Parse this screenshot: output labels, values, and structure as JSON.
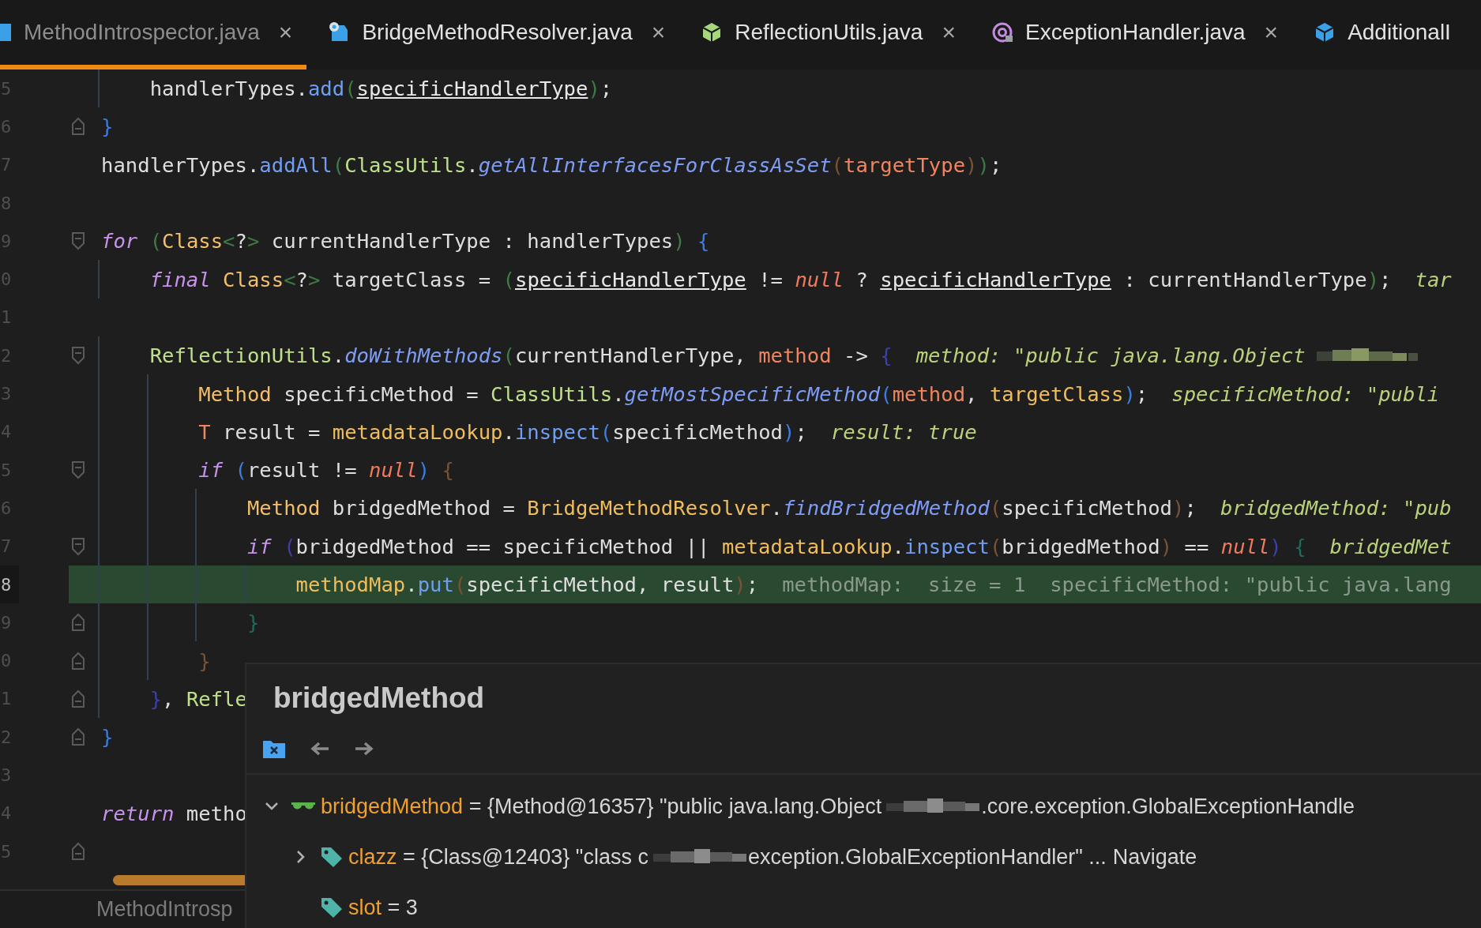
{
  "tabs": [
    {
      "label": "MethodIntrospector.java",
      "selected": true,
      "close": "×",
      "icon": {
        "kind": "class",
        "color": "#3aa0e8"
      }
    },
    {
      "label": "BridgeMethodResolver.java",
      "selected": false,
      "close": "×",
      "icon": {
        "kind": "class-gear",
        "color": "#3aa0e8"
      }
    },
    {
      "label": "ReflectionUtils.java",
      "selected": false,
      "close": "×",
      "icon": {
        "kind": "cube",
        "color": "#a6d77a"
      }
    },
    {
      "label": "ExceptionHandler.java",
      "selected": false,
      "close": "×",
      "icon": {
        "kind": "annotation",
        "color": "#c38ae0"
      }
    },
    {
      "label": "AdditionalI",
      "selected": false,
      "icon": {
        "kind": "cube",
        "color": "#3aa0e8"
      }
    }
  ],
  "lines": [
    {
      "number": "5",
      "kind": "plain",
      "highlighted": false,
      "tokens": [
        {
          "kind": "plain",
          "text": "    handlerTypes."
        },
        {
          "kind": "call",
          "text": "add"
        },
        {
          "kind": "bracket",
          "text": "(",
          "color": "#3f7a45"
        },
        {
          "kind": "field",
          "text": "specificHandlerType"
        },
        {
          "kind": "bracket",
          "text": ")",
          "color": "#3f7a45"
        },
        {
          "kind": "plain",
          "text": ";"
        }
      ]
    },
    {
      "number": "6",
      "kind": "fold-end",
      "highlighted": false,
      "tokens": [
        {
          "kind": "bracket",
          "text": "}",
          "color": "#3b7de0"
        }
      ]
    },
    {
      "number": "7",
      "kind": "plain",
      "highlighted": false,
      "tokens": [
        {
          "kind": "plain",
          "text": "handlerTypes."
        },
        {
          "kind": "call",
          "text": "addAll"
        },
        {
          "kind": "bracket",
          "text": "(",
          "color": "#3f7a45"
        },
        {
          "kind": "cls",
          "text": "ClassUtils"
        },
        {
          "kind": "plain",
          "text": "."
        },
        {
          "kind": "static",
          "text": "getAllInterfacesForClassAsSet"
        },
        {
          "kind": "bracket",
          "text": "(",
          "color": "#7a5236"
        },
        {
          "kind": "param",
          "text": "targetType"
        },
        {
          "kind": "bracket",
          "text": ")",
          "color": "#7a5236"
        },
        {
          "kind": "bracket",
          "text": ")",
          "color": "#3f7a45"
        },
        {
          "kind": "plain",
          "text": ";"
        }
      ]
    },
    {
      "number": "8",
      "kind": "plain",
      "highlighted": false
    },
    {
      "number": "9",
      "kind": "fold-start",
      "highlighted": false,
      "tokens": [
        {
          "kind": "kw",
          "text": "for "
        },
        {
          "kind": "bracket",
          "text": "(",
          "color": "#3f7a45"
        },
        {
          "kind": "type",
          "text": "Class"
        },
        {
          "kind": "bracket",
          "text": "<",
          "color": "#3f7a45"
        },
        {
          "kind": "plain",
          "text": "?"
        },
        {
          "kind": "bracket",
          "text": ">",
          "color": "#3f7a45"
        },
        {
          "kind": "plain",
          "text": " currentHandlerType : handlerTypes"
        },
        {
          "kind": "bracket",
          "text": ")",
          "color": "#3f7a45"
        },
        {
          "kind": "bracket",
          "text": " {",
          "color": "#3b7de0"
        }
      ]
    },
    {
      "number": "0",
      "kind": "plain",
      "highlighted": false,
      "tokens": [
        {
          "kind": "kw",
          "text": "    final "
        },
        {
          "kind": "type",
          "text": "Class"
        },
        {
          "kind": "bracket",
          "text": "<",
          "color": "#3f7a45"
        },
        {
          "kind": "plain",
          "text": "?"
        },
        {
          "kind": "bracket",
          "text": ">",
          "color": "#3f7a45"
        },
        {
          "kind": "plain",
          "text": " targetClass = "
        },
        {
          "kind": "bracket",
          "text": "(",
          "color": "#3f7a45"
        },
        {
          "kind": "field",
          "text": "specificHandlerType"
        },
        {
          "kind": "plain",
          "text": " != "
        },
        {
          "kind": "null",
          "text": "null"
        },
        {
          "kind": "plain",
          "text": " ? "
        },
        {
          "kind": "field",
          "text": "specificHandlerType"
        },
        {
          "kind": "plain",
          "text": " : currentHandlerType"
        },
        {
          "kind": "bracket",
          "text": ")",
          "color": "#3f7a45"
        },
        {
          "kind": "plain",
          "text": ";"
        }
      ],
      "hint": {
        "text": "tar"
      }
    },
    {
      "number": "1",
      "kind": "plain",
      "highlighted": false
    },
    {
      "number": "2",
      "kind": "fold-start",
      "highlighted": false,
      "tokens": [
        {
          "kind": "cls",
          "text": "    ReflectionUtils"
        },
        {
          "kind": "plain",
          "text": "."
        },
        {
          "kind": "static",
          "text": "doWithMethods"
        },
        {
          "kind": "bracket",
          "text": "(",
          "color": "#3f7a45"
        },
        {
          "kind": "plain",
          "text": "currentHandlerType, "
        },
        {
          "kind": "param",
          "text": "method"
        },
        {
          "kind": "plain",
          "text": " -> "
        },
        {
          "kind": "bracket",
          "text": "{",
          "color": "#3c40a8"
        }
      ],
      "hint": {
        "text": "method: \"public java.lang.Object",
        "redacted": true
      }
    },
    {
      "number": "3",
      "kind": "plain",
      "highlighted": false,
      "tokens": [
        {
          "kind": "type",
          "text": "        Method"
        },
        {
          "kind": "plain",
          "text": " specificMethod = "
        },
        {
          "kind": "cls",
          "text": "ClassUtils"
        },
        {
          "kind": "plain",
          "text": "."
        },
        {
          "kind": "static",
          "text": "getMostSpecificMethod"
        },
        {
          "kind": "bracket",
          "text": "(",
          "color": "#3b7de0"
        },
        {
          "kind": "param",
          "text": "method"
        },
        {
          "kind": "plain",
          "text": ", "
        },
        {
          "kind": "local",
          "text": "targetClass"
        },
        {
          "kind": "bracket",
          "text": ")",
          "color": "#3b7de0"
        },
        {
          "kind": "plain",
          "text": ";"
        }
      ],
      "hint": {
        "text": "specificMethod: \"publi"
      }
    },
    {
      "number": "4",
      "kind": "plain",
      "highlighted": false,
      "tokens": [
        {
          "kind": "param",
          "text": "        T"
        },
        {
          "kind": "plain",
          "text": " result = "
        },
        {
          "kind": "local",
          "text": "metadataLookup"
        },
        {
          "kind": "plain",
          "text": "."
        },
        {
          "kind": "call",
          "text": "inspect"
        },
        {
          "kind": "bracket",
          "text": "(",
          "color": "#3b7de0"
        },
        {
          "kind": "plain",
          "text": "specificMethod"
        },
        {
          "kind": "bracket",
          "text": ")",
          "color": "#3b7de0"
        },
        {
          "kind": "plain",
          "text": ";"
        }
      ],
      "hint": {
        "text": "result: true"
      }
    },
    {
      "number": "5",
      "kind": "fold-start",
      "highlighted": false,
      "tokens": [
        {
          "kind": "kw",
          "text": "        if "
        },
        {
          "kind": "bracket",
          "text": "(",
          "color": "#3b7de0"
        },
        {
          "kind": "plain",
          "text": "result != "
        },
        {
          "kind": "null",
          "text": "null"
        },
        {
          "kind": "bracket",
          "text": ")",
          "color": "#3b7de0"
        },
        {
          "kind": "bracket",
          "text": " {",
          "color": "#7a5236"
        }
      ]
    },
    {
      "number": "6",
      "kind": "plain",
      "highlighted": false,
      "tokens": [
        {
          "kind": "type",
          "text": "            Method"
        },
        {
          "kind": "plain",
          "text": " bridgedMethod = "
        },
        {
          "kind": "local",
          "text": "BridgeMethodResolver"
        },
        {
          "kind": "plain",
          "text": "."
        },
        {
          "kind": "static",
          "text": "findBridgedMethod"
        },
        {
          "kind": "bracket",
          "text": "(",
          "color": "#7a5236"
        },
        {
          "kind": "plain",
          "text": "specificMethod"
        },
        {
          "kind": "bracket",
          "text": ")",
          "color": "#7a5236"
        },
        {
          "kind": "plain",
          "text": ";"
        }
      ],
      "hint": {
        "text": "bridgedMethod: \"pub"
      }
    },
    {
      "number": "7",
      "kind": "fold-start",
      "highlighted": false,
      "tokens": [
        {
          "kind": "kw",
          "text": "            if "
        },
        {
          "kind": "bracket",
          "text": "(",
          "color": "#3c40a8"
        },
        {
          "kind": "plain",
          "text": "bridgedMethod == specificMethod || "
        },
        {
          "kind": "local",
          "text": "metadataLookup"
        },
        {
          "kind": "plain",
          "text": "."
        },
        {
          "kind": "call",
          "text": "inspect"
        },
        {
          "kind": "bracket",
          "text": "(",
          "color": "#7a5236"
        },
        {
          "kind": "plain",
          "text": "bridgedMethod"
        },
        {
          "kind": "bracket",
          "text": ")",
          "color": "#7a5236"
        },
        {
          "kind": "plain",
          "text": " == "
        },
        {
          "kind": "null",
          "text": "null"
        },
        {
          "kind": "bracket",
          "text": ")",
          "color": "#3c40a8"
        },
        {
          "kind": "bracket",
          "text": " {",
          "color": "#1f6b5a"
        }
      ],
      "hint": {
        "text": "bridgedMet"
      }
    },
    {
      "number": "8",
      "kind": "plain",
      "highlighted": true,
      "tokens": [
        {
          "kind": "local",
          "text": "                methodMap"
        },
        {
          "kind": "plain",
          "text": "."
        },
        {
          "kind": "call",
          "text": "put"
        },
        {
          "kind": "bracket",
          "text": "(",
          "color": "#7a5236"
        },
        {
          "kind": "plain",
          "text": "specificMethod, result"
        },
        {
          "kind": "bracket",
          "text": ")",
          "color": "#7a5236"
        },
        {
          "kind": "plain",
          "text": ";"
        }
      ],
      "hint": {
        "text": "methodMap:  size = 1  specificMethod: \"public java.lang"
      }
    },
    {
      "number": "9",
      "kind": "fold-end",
      "highlighted": false,
      "tokens": [
        {
          "kind": "bracket",
          "text": "            }",
          "color": "#1f6b5a"
        }
      ]
    },
    {
      "number": "0",
      "kind": "fold-end",
      "highlighted": false,
      "tokens": [
        {
          "kind": "bracket",
          "text": "        }",
          "color": "#7a5236"
        }
      ]
    },
    {
      "number": "1",
      "kind": "fold-end",
      "highlighted": false,
      "tokens": [
        {
          "kind": "bracket",
          "text": "    }",
          "color": "#3c40a8"
        },
        {
          "kind": "plain",
          "text": ", "
        },
        {
          "kind": "cls",
          "text": "Refle"
        }
      ]
    },
    {
      "number": "2",
      "kind": "fold-end",
      "highlighted": false,
      "tokens": [
        {
          "kind": "bracket",
          "text": "}",
          "color": "#3b7de0"
        }
      ]
    },
    {
      "number": "3",
      "kind": "plain",
      "highlighted": false
    },
    {
      "number": "4",
      "kind": "plain",
      "highlighted": false,
      "tokens": [
        {
          "kind": "kw",
          "text": "return"
        },
        {
          "kind": "plain",
          "text": " metho"
        }
      ]
    },
    {
      "number": "5",
      "kind": "fold-end",
      "highlighted": false
    }
  ],
  "debug_popup": {
    "title": "bridgedMethod",
    "tree": [
      {
        "name": "bridgedMethod",
        "kind": "watch",
        "expanded": true,
        "value": [
          {
            "kind": "text",
            "text": " = {Method@16357} \"public java.lang.Object"
          },
          {
            "kind": "redacted"
          },
          {
            "kind": "text",
            "text": ".core.exception.GlobalExceptionHandle"
          }
        ],
        "children": [
          {
            "name": "clazz",
            "kind": "field",
            "expanded": false,
            "value": [
              {
                "kind": "text",
                "text": " = {Class@12403} \"class c"
              },
              {
                "kind": "redacted"
              },
              {
                "kind": "text",
                "text": "exception.GlobalExceptionHandler\" ..."
              },
              {
                "kind": "link",
                "text": "Navigate"
              }
            ]
          },
          {
            "name": "slot",
            "kind": "field",
            "value": [
              {
                "kind": "text",
                "text": " = 3"
              }
            ]
          }
        ]
      }
    ]
  },
  "bottom_tab": {
    "label": "MethodIntrosp"
  }
}
